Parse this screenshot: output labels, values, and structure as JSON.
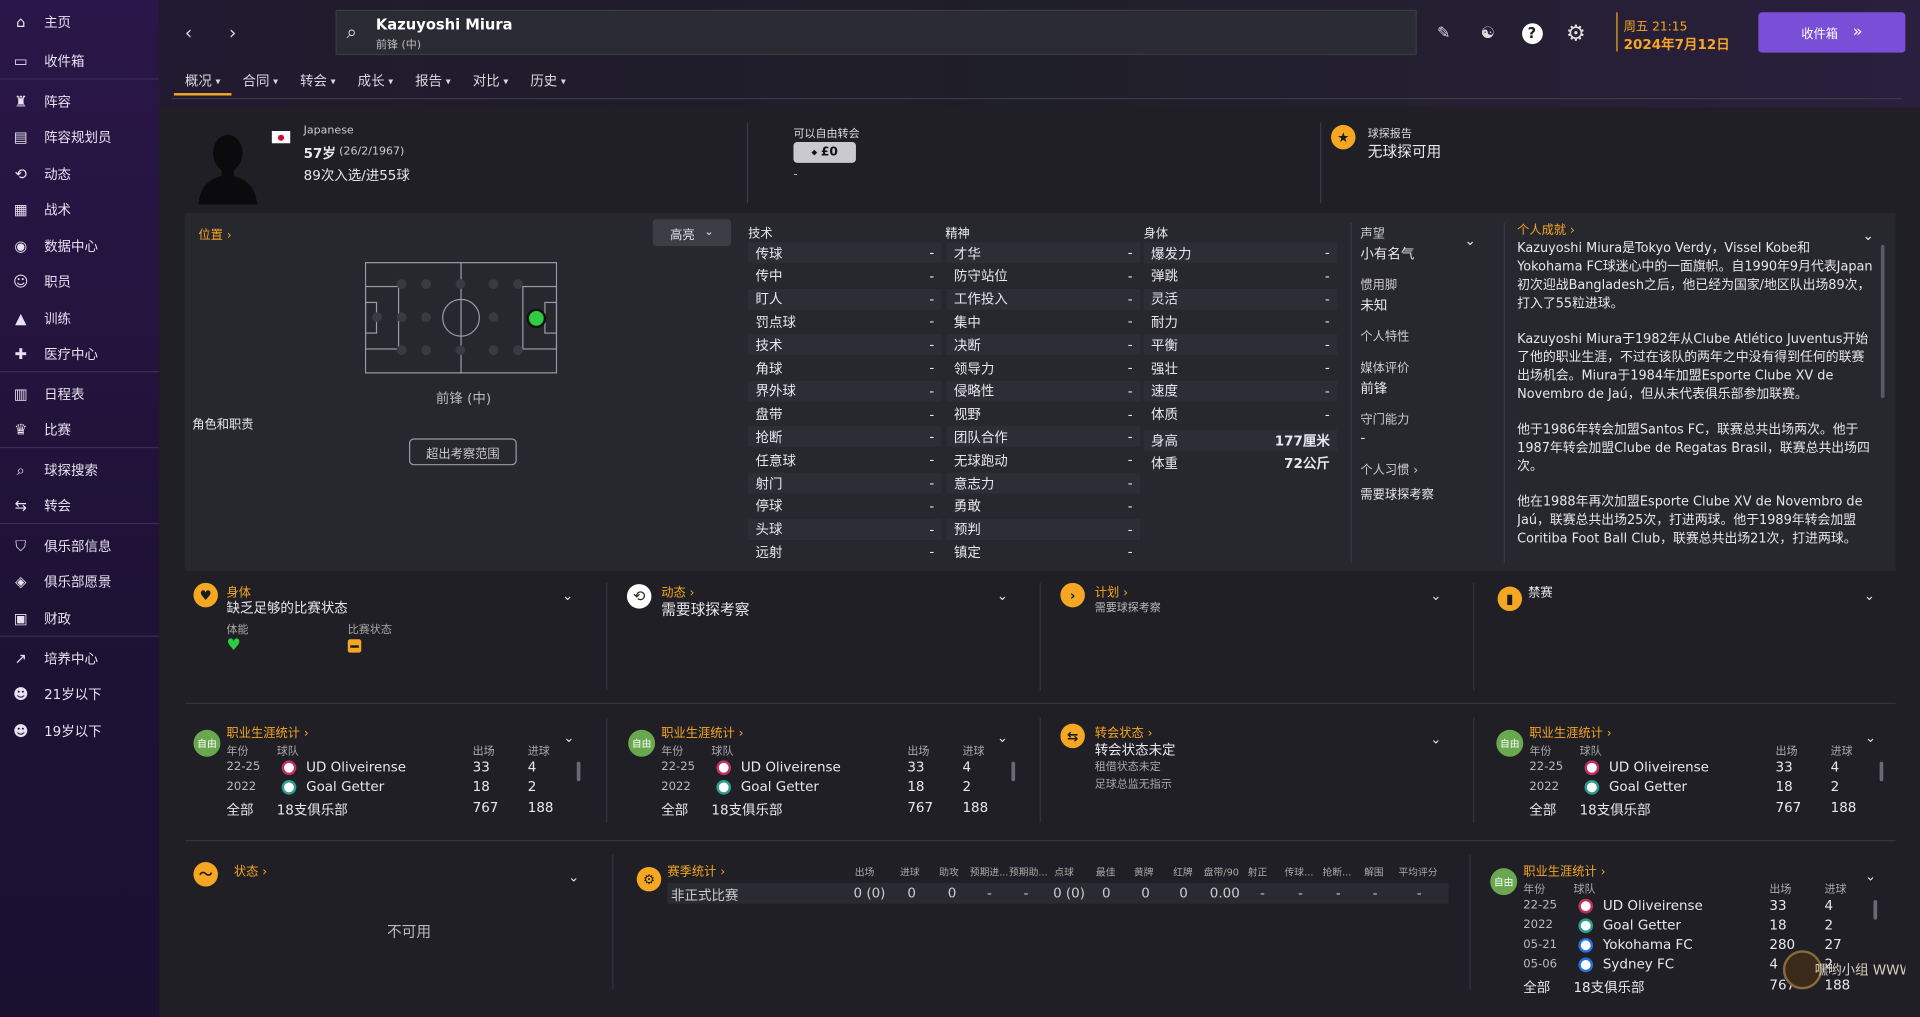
{
  "sidebar": {
    "items": [
      {
        "label": "主页",
        "icon": "home-icon"
      },
      {
        "label": "收件箱",
        "icon": "inbox-icon"
      },
      {
        "label": "阵容",
        "icon": "squad-icon"
      },
      {
        "label": "阵容规划员",
        "icon": "planner-icon"
      },
      {
        "label": "动态",
        "icon": "dynamics-icon"
      },
      {
        "label": "战术",
        "icon": "tactics-icon"
      },
      {
        "label": "数据中心",
        "icon": "data-icon"
      },
      {
        "label": "职员",
        "icon": "staff-icon"
      },
      {
        "label": "训练",
        "icon": "training-icon"
      },
      {
        "label": "医疗中心",
        "icon": "medical-icon"
      },
      {
        "label": "日程表",
        "icon": "calendar-icon"
      },
      {
        "label": "比赛",
        "icon": "trophy-icon"
      },
      {
        "label": "球探搜索",
        "icon": "search-icon"
      },
      {
        "label": "转会",
        "icon": "transfer-icon"
      },
      {
        "label": "俱乐部信息",
        "icon": "club-icon"
      },
      {
        "label": "俱乐部愿景",
        "icon": "vision-icon"
      },
      {
        "label": "财政",
        "icon": "finance-icon"
      },
      {
        "label": "培养中心",
        "icon": "development-icon"
      },
      {
        "label": "21岁以下",
        "icon": "u21-icon"
      },
      {
        "label": "19岁以下",
        "icon": "u19-icon"
      }
    ]
  },
  "header": {
    "player_name": "Kazuyoshi Miura",
    "player_position": "前锋 (中)",
    "datetime": "周五 21:15",
    "date": "2024年7月12日",
    "inbox_button": "收件箱",
    "tabs": [
      "概况",
      "合同",
      "转会",
      "成长",
      "报告",
      "对比",
      "历史"
    ]
  },
  "profile": {
    "nationality": "Japanese",
    "age": "57岁",
    "dob": "(26/2/1967)",
    "caps": "89次入选/进55球",
    "transfer_label": "可以自由转会",
    "transfer_value": "£0",
    "transfer_sub": "-",
    "scout_label": "球探报告",
    "scout_value": "无球探可用"
  },
  "position": {
    "title": "位置",
    "pos_label": "前锋 (中)",
    "role_label": "角色和职责",
    "out_of_range": "超出考察范围",
    "highlight": "高亮"
  },
  "attributes": {
    "technical_title": "技术",
    "mental_title": "精神",
    "physical_title": "身体",
    "technical": [
      "传球",
      "传中",
      "盯人",
      "罚点球",
      "技术",
      "角球",
      "界外球",
      "盘带",
      "抢断",
      "任意球",
      "射门",
      "停球",
      "头球",
      "远射"
    ],
    "mental": [
      "才华",
      "防守站位",
      "工作投入",
      "集中",
      "决断",
      "领导力",
      "侵略性",
      "视野",
      "团队合作",
      "无球跑动",
      "意志力",
      "勇敢",
      "预判",
      "镇定"
    ],
    "physical": [
      "爆发力",
      "弹跳",
      "灵活",
      "耐力",
      "平衡",
      "强壮",
      "速度",
      "体质"
    ],
    "value": "-",
    "height_label": "身高",
    "height_value": "177厘米",
    "weight_label": "体重",
    "weight_value": "72公斤"
  },
  "info": {
    "reputation_label": "声望",
    "reputation_value": "小有名气",
    "foot_label": "惯用脚",
    "foot_value": "未知",
    "traits_label": "个人特性",
    "media_label": "媒体评价",
    "media_value": "前锋",
    "gk_label": "守门能力",
    "gk_value": "-",
    "habits_label": "个人习惯",
    "habits_value": "需要球探考察"
  },
  "achievements": {
    "title": "个人成就",
    "paragraphs": [
      "Kazuyoshi Miura是Tokyo Verdy，Vissel Kobe和Yokohama FC球迷心中的一面旗帜。自1990年9月代表Japan初次迎战Bangladesh之后，他已经为国家/地区队出场89次，打入了55粒进球。",
      "Kazuyoshi Miura于1982年从Clube Atlético Juventus开始了他的职业生涯，不过在该队的两年之中没有得到任何的联赛出场机会。Miura于1984年加盟Esporte Clube XV de Novembro de Jaú，但从未代表俱乐部参加联赛。",
      "他于1986年转会加盟Santos FC，联赛总共出场两次。他于1987年转会加盟Clube de Regatas Brasil，联赛总共出场四次。",
      "他在1988年再次加盟Esporte Clube XV de Novembro de Jaú，联赛总共出场25次，打进两球。他于1989年转会加盟Coritiba Foot Ball Club，联赛总共出场21次，打进两球。"
    ]
  },
  "cards_row1": [
    {
      "title": "身体",
      "value": "缺乏足够的比赛状态",
      "fitness_label": "体能",
      "match_label": "比赛状态"
    },
    {
      "title": "动态",
      "value": "需要球探考察"
    },
    {
      "title": "计划",
      "value": "需要球探考察"
    },
    {
      "title": "禁赛",
      "value": ""
    }
  ],
  "career": {
    "title": "职业生涯统计",
    "free_badge": "自由",
    "col_year": "年份",
    "col_team": "球队",
    "col_apps": "出场",
    "col_goals": "进球",
    "rows": [
      {
        "year": "22-25",
        "team": "UD Oliveirense",
        "apps": "33",
        "goals": "4"
      },
      {
        "year": "2022",
        "team": "Goal Getter",
        "apps": "18",
        "goals": "2"
      }
    ],
    "rows_long": [
      {
        "year": "22-25",
        "team": "UD Oliveirense",
        "apps": "33",
        "goals": "4"
      },
      {
        "year": "2022",
        "team": "Goal Getter",
        "apps": "18",
        "goals": "2"
      },
      {
        "year": "05-21",
        "team": "Yokohama FC",
        "apps": "280",
        "goals": "27"
      },
      {
        "year": "05-06",
        "team": "Sydney FC",
        "apps": "4",
        "goals": "2"
      }
    ],
    "total_label": "全部",
    "total_team": "18支俱乐部",
    "total_apps": "767",
    "total_goals": "188"
  },
  "transfer_status": {
    "title": "转会状态",
    "value": "转会状态未定",
    "loan": "租借状态未定",
    "director": "足球总监无指示"
  },
  "form": {
    "title": "状态",
    "value": "不可用"
  },
  "season": {
    "title": "赛季统计",
    "headers": [
      "出场",
      "进球",
      "助攻",
      "预期进...",
      "预期助...",
      "点球",
      "最佳",
      "黄牌",
      "红牌",
      "盘带/90",
      "射正",
      "传球...",
      "抢断...",
      "解围",
      "平均评分"
    ],
    "row_label": "非正式比赛",
    "row_values": [
      "0 (0)",
      "0",
      "0",
      "-",
      "-",
      "0 (0)",
      "0",
      "0",
      "0",
      "0.00",
      "-",
      "-",
      "-",
      "-",
      "-"
    ]
  },
  "watermark": "嘿哟小组 WWW.PLAYSM.CC",
  "colors": {
    "accent": "#f5a623",
    "sidebar": "#2a1648",
    "inbox": "#7a4fd8"
  }
}
